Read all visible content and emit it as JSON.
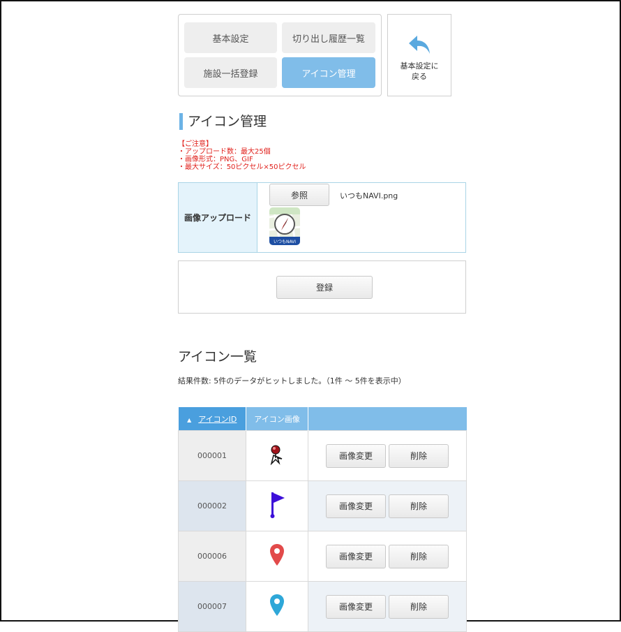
{
  "nav": {
    "items": [
      {
        "label": "基本設定"
      },
      {
        "label": "切り出し履歴一覧"
      },
      {
        "label": "施設一括登録"
      },
      {
        "label": "アイコン管理"
      }
    ],
    "back_label": "基本設定に戻る"
  },
  "section_title": "アイコン管理",
  "notes": [
    "【ご注意】",
    "・アップロード数：最大25個",
    "・画像形式：PNG、GIF",
    "・最大サイズ：50ピクセル×50ピクセル"
  ],
  "upload": {
    "label": "画像アップロード",
    "browse_label": "参照",
    "filename": "いつもNAVI.png",
    "preview_caption": "いつもNAVI"
  },
  "register_label": "登録",
  "list": {
    "title": "アイコン一覧",
    "result_text": "結果件数: 5件のデータがヒットしました。（1件 ～ 5件を表示中）",
    "columns": {
      "id": "アイコンID",
      "image": "アイコン画像",
      "actions": ""
    },
    "change_label": "画像変更",
    "delete_label": "削除",
    "rows": [
      {
        "id": "000001",
        "icon": "red-pin-hand-icon"
      },
      {
        "id": "000002",
        "icon": "purple-flag-icon"
      },
      {
        "id": "000006",
        "icon": "red-map-pin-icon"
      },
      {
        "id": "000007",
        "icon": "blue-map-pin-icon"
      }
    ]
  },
  "colors": {
    "accent": "#80bde9",
    "header_sorted": "#4a9fde",
    "notice": "#e0201b"
  }
}
